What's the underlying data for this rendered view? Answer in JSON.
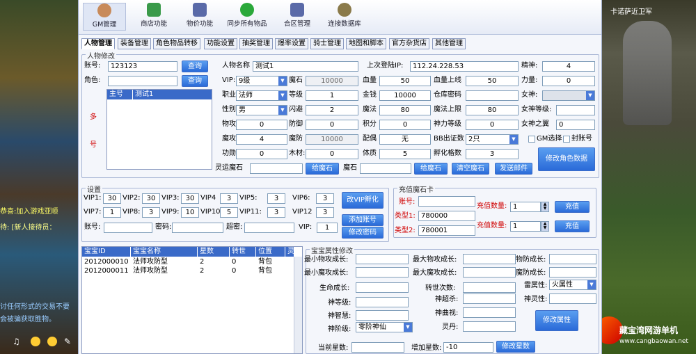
{
  "game": {
    "npc_name": "卡诺萨近卫军",
    "chat1": "恭喜:加入游戏亚顺",
    "chat2": "待: [新人接待员：",
    "chat3": "讨任何形式的交易不要",
    "chat4": "会被骗获取胜物。"
  },
  "toolbar": [
    {
      "label": "GM管理"
    },
    {
      "label": "商店功能"
    },
    {
      "label": "物价功能"
    },
    {
      "label": "同步所有物品"
    },
    {
      "label": "合区管理"
    },
    {
      "label": "连接数据库"
    }
  ],
  "tabs": [
    "人物管理",
    "装备管理",
    "角色物品转移",
    "功能设置",
    "抽奖管理",
    "爆率设置",
    "骑士管理",
    "地图和脚本",
    "官方杂货店",
    "其他管理"
  ],
  "char": {
    "group_title": "人物修改",
    "account_label": "账号:",
    "account_value": "123123",
    "query1": "查询",
    "role_label": "角色:",
    "role_value": "",
    "query2": "查询",
    "list_head1": "主号",
    "list_head2": "测试1",
    "side_label1": "多",
    "side_label2": "号",
    "name_label": "人物名称",
    "name_value": "测试1",
    "lastip_label": "上次登陆IP:",
    "lastip_value": "112.24.228.53",
    "jingshen_label": "精神:",
    "jingshen_value": "4",
    "vip_label": "VIP:",
    "vip_value": "9级",
    "moshi_label": "魔石",
    "moshi_value": "10000",
    "xueliang_label": "血量",
    "xueliang_value": "50",
    "xlsx_label": "血量上线",
    "xlsx_value": "50",
    "liliang_label": "力量:",
    "liliang_value": "0",
    "job_label": "职业",
    "job_value": "法师",
    "level_label": "等级",
    "level_value": "1",
    "gold_label": "金钱",
    "gold_value": "10000",
    "ckmm_label": "仓库密码",
    "ckmm_value": "",
    "nvshen_label": "女神:",
    "nvshen_value": "",
    "sex_label": "性别:",
    "sex_value": "男",
    "shanbi_label": "闪避",
    "shanbi_value": "2",
    "mofa_label": "魔法",
    "mofa_value": "80",
    "mfsx_label": "魔法上限",
    "mfsx_value": "80",
    "nsdj_label": "女神等级:",
    "nsdj_value": "",
    "wugong_label": "物攻",
    "wugong_value": "0",
    "fangyu_label": "防御",
    "fangyu_value": "0",
    "jifen_label": "积分",
    "jifen_value": "0",
    "slsx_label": "神力等级",
    "slsx_value": "0",
    "nszz_label": "女神之翼",
    "nszz_value": "0",
    "mogong_label": "魔攻",
    "mogong_value": "4",
    "mofang_label": "魔防",
    "mofang_value": "10000",
    "peiou_label": "配偶",
    "peiou_value": "无",
    "cszs_label": "BB出证数",
    "cszs_value": "2只",
    "gm_check": "GM选择",
    "ban_check": "封账号",
    "gongxun_label": "功勋:",
    "gongxun_value": "0",
    "mucai_label": "木材:",
    "mucai_value": "0",
    "tizhi_label": "体质",
    "tizhi_value": "5",
    "fhgs_label": "孵化格数",
    "fhgs_value": "3",
    "lyms_label": "灵运魔石",
    "lyms_value": "",
    "give_btn": "给魔石",
    "ms2_label": "魔石",
    "ms2_value": "",
    "give2_btn": "给魔石",
    "clear_btn": "清空魔石",
    "mail_btn": "发送邮件",
    "modify_btn": "修改角色数据"
  },
  "settings": {
    "group_title": "设置",
    "vip": [
      {
        "label": "VIP1:",
        "value": "30"
      },
      {
        "label": "VIP2:",
        "value": "30"
      },
      {
        "label": "VIP3:",
        "value": "30"
      },
      {
        "label": "VIP4",
        "value": "3"
      },
      {
        "label": "VIP5:",
        "value": "3"
      },
      {
        "label": "VIP6:",
        "value": "3"
      },
      {
        "label": "VIP7:",
        "value": "1"
      },
      {
        "label": "VIP8:",
        "value": "3"
      },
      {
        "label": "VIP9:",
        "value": "10"
      },
      {
        "label": "VIP10:",
        "value": "5"
      },
      {
        "label": "VIP11:",
        "value": "3"
      },
      {
        "label": "VIP12",
        "value": "3"
      }
    ],
    "acct_label": "账号:",
    "pwd_label": "密码:",
    "super_label": "超密:",
    "vip_label": "VIP:",
    "vip_value": "1",
    "chg_vip_btn": "改VIP孵化",
    "add_acct_btn": "添加账号",
    "chg_pwd_btn": "修改密码"
  },
  "recharge": {
    "group_title": "充值魔石卡",
    "acct_label": "账号:",
    "acct_value": "",
    "type1_label": "类型1:",
    "type1_value": "780000",
    "type2_label": "类型2:",
    "type2_value": "780001",
    "qty1_label": "充值数量:",
    "qty1_value": "1",
    "qty2_label": "充值数量:",
    "qty2_value": "1",
    "btn1": "充值",
    "btn2": "充值"
  },
  "pets": {
    "headers": [
      "宝宝ID",
      "宝宝名称",
      "星数",
      "转世",
      "位置",
      "灵?"
    ],
    "rows": [
      [
        "2012000010",
        "法师攻防型",
        "2",
        "0",
        "背包",
        "0"
      ],
      [
        "2012000011",
        "法师攻防型",
        "2",
        "0",
        "背包",
        "0"
      ]
    ]
  },
  "petattr": {
    "group_title": "宝宝属性修改",
    "min_wg_label": "最小物攻成长:",
    "max_wg_label": "最大物攻成长:",
    "wf_label": "物防成长:",
    "min_mg_label": "最小魔攻成长:",
    "max_mg_label": "最大魔攻成长:",
    "mf_label": "魔防成长:",
    "sm_label": "生命成长:",
    "zs_label": "转世次数:",
    "lsx_label": "雷属性:",
    "lsx_value": "火属性",
    "sdj_label": "神等级:",
    "sjb_label": "神超杀:",
    "sll_label": "神灵性:",
    "szh_label": "神智慧:",
    "ssy_label": "神曲视:",
    "sjj_label": "神阶级:",
    "sjj_value": "零阶神仙",
    "ld_label": "灵丹:",
    "modify_btn": "修改属性",
    "cur_star_label": "当前星数:",
    "add_star_label": "增加星数:",
    "add_star_value": "-10",
    "star_btn": "修改星数"
  },
  "watermark": {
    "text1": "藏宝湾网游单机",
    "text2": "www.cangbaowan.net"
  }
}
